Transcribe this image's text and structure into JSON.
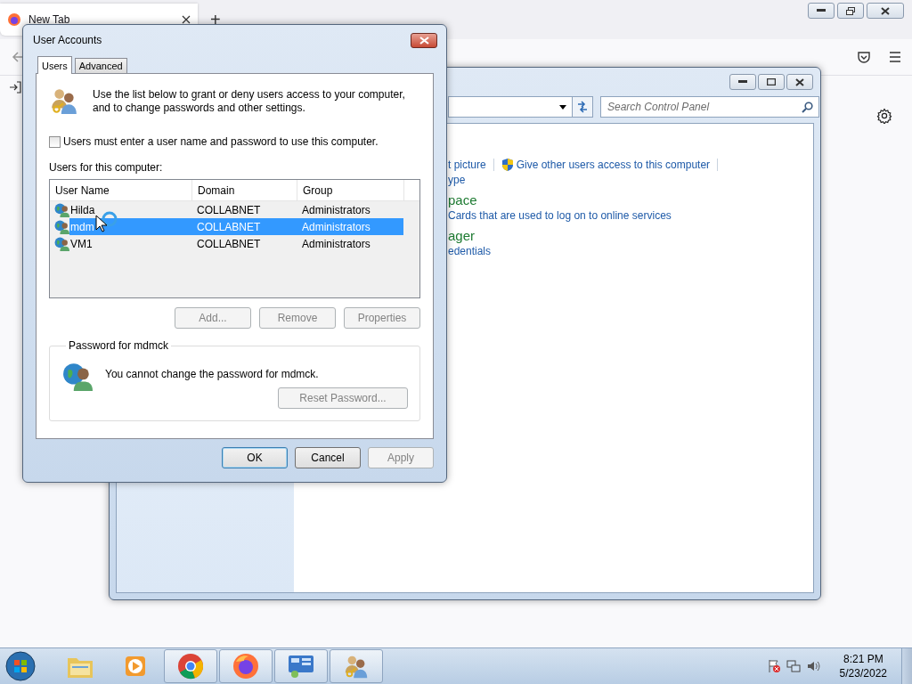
{
  "browser": {
    "tabs": [
      {
        "label": "New Tab",
        "selected": true
      }
    ],
    "new_tab": "+"
  },
  "control_panel": {
    "search": {
      "placeholder": "Search Control Panel"
    },
    "sections": [
      {
        "links": [
          {
            "label": "t picture",
            "shield": false
          },
          {
            "label": "Give other users access to this computer",
            "shield": true
          }
        ],
        "sublinks": [
          "ype"
        ]
      },
      {
        "heading": "pace",
        "sublinks": [
          "Cards that are used to log on to online services"
        ]
      },
      {
        "heading": "ager",
        "sublinks": [
          "edentials"
        ]
      }
    ]
  },
  "dialog": {
    "title": "User Accounts",
    "tabs": [
      {
        "label": "Users",
        "selected": true
      },
      {
        "label": "Advanced",
        "selected": false
      }
    ],
    "intro": [
      "Use the list below to grant or deny users access to your computer,",
      "and to change passwords and other settings."
    ],
    "require_login": {
      "label": "Users must enter a user name and password to use this computer.",
      "checked": false
    },
    "users_label": "Users for this computer:",
    "columns": [
      "User Name",
      "Domain",
      "Group"
    ],
    "rows": [
      {
        "name": "Hilda",
        "domain": "COLLABNET",
        "group": "Administrators",
        "selected": false
      },
      {
        "name": "mdm",
        "domain": "COLLABNET",
        "group": "Administrators",
        "selected": true
      },
      {
        "name": "VM1",
        "domain": "COLLABNET",
        "group": "Administrators",
        "selected": false
      }
    ],
    "list_buttons": [
      {
        "label": "Add...",
        "disabled": true
      },
      {
        "label": "Remove",
        "disabled": true
      },
      {
        "label": "Properties",
        "disabled": true
      }
    ],
    "password_group": {
      "title": "Password for mdmck",
      "message": "You cannot change the password for mdmck.",
      "button": {
        "label": "Reset Password...",
        "disabled": true
      }
    },
    "buttons": [
      {
        "label": "OK",
        "default": true,
        "disabled": false
      },
      {
        "label": "Cancel",
        "default": false,
        "disabled": false
      },
      {
        "label": "Apply",
        "default": false,
        "disabled": true
      }
    ]
  },
  "taskbar": {
    "apps": [
      {
        "kind": "explorer",
        "running": false
      },
      {
        "kind": "media",
        "running": false
      },
      {
        "kind": "chrome",
        "running": true
      },
      {
        "kind": "firefox",
        "running": true
      },
      {
        "kind": "control",
        "running": true
      },
      {
        "kind": "users",
        "running": true
      }
    ],
    "clock": {
      "time": "8:21 PM",
      "date": "5/23/2022"
    }
  }
}
